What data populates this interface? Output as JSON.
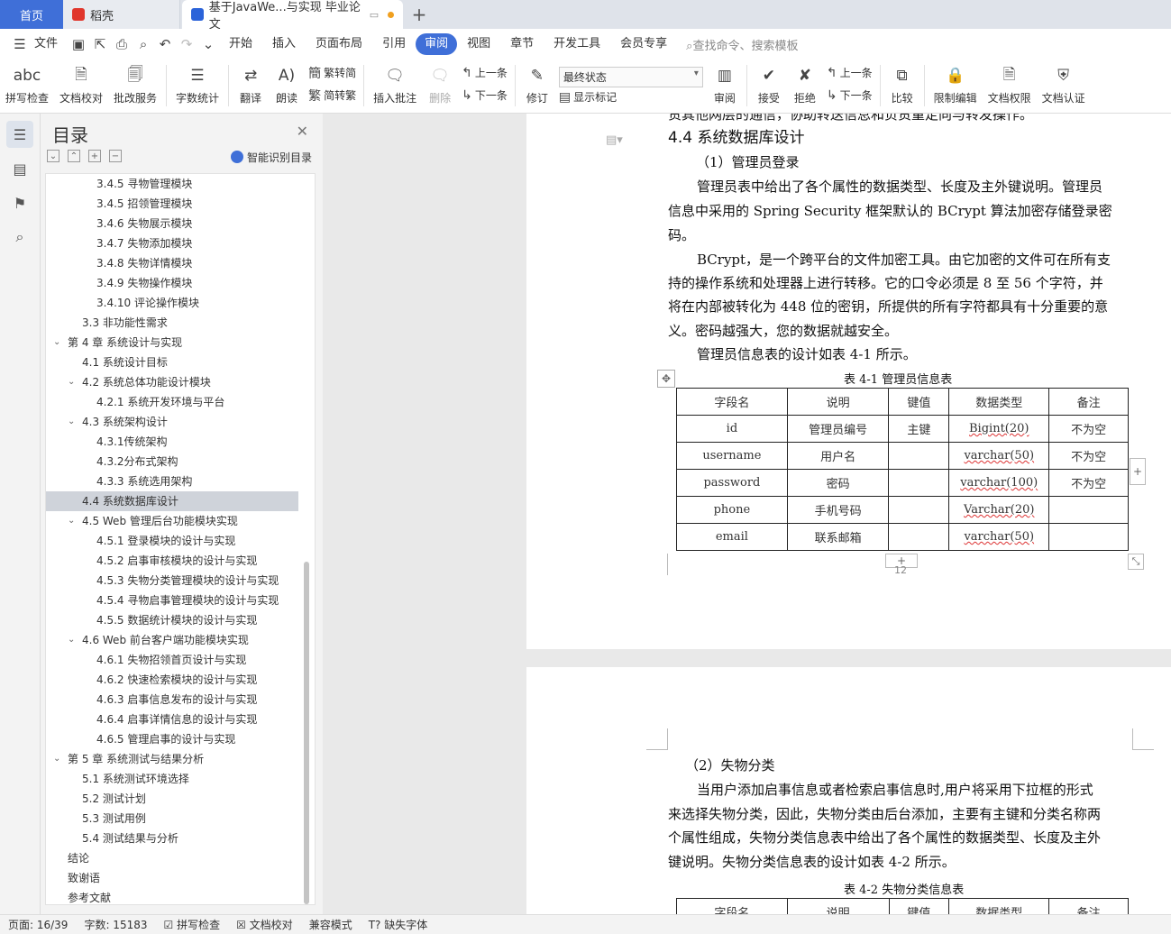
{
  "tabs": {
    "home": "首页",
    "daoke": "稻壳",
    "doc": "基于JavaWe...与实现 毕业论文"
  },
  "menu": {
    "file": "文件",
    "items": [
      "开始",
      "插入",
      "页面布局",
      "引用",
      "审阅",
      "视图",
      "章节",
      "开发工具",
      "会员专享"
    ],
    "active": "审阅",
    "search": "查找命令、搜索模板"
  },
  "toolbar": {
    "spell": "拼写检查",
    "proof": "文档校对",
    "annot": "批改服务",
    "wordcount": "字数统计",
    "translate": "翻译",
    "read": "朗读",
    "t2s": "繁转简",
    "s2t": "简转繁",
    "insert_comment": "插入批注",
    "delete": "删除",
    "prev": "上一条",
    "next": "下一条",
    "revise": "修订",
    "state": "最终状态",
    "show_marks": "显示标记",
    "review": "审阅",
    "accept": "接受",
    "reject": "拒绝",
    "prev2": "上一条",
    "next2": "下一条",
    "compare": "比较",
    "restrict": "限制编辑",
    "perm": "文档权限",
    "auth": "文档认证"
  },
  "toc": {
    "title": "目录",
    "smart": "智能识别目录",
    "items": [
      {
        "t": "3.4.5  寻物管理模块",
        "l": 3
      },
      {
        "t": "3.4.5  招领管理模块",
        "l": 3
      },
      {
        "t": "3.4.6  失物展示模块",
        "l": 3
      },
      {
        "t": "3.4.7  失物添加模块",
        "l": 3
      },
      {
        "t": "3.4.8  失物详情模块",
        "l": 3
      },
      {
        "t": "3.4.9  失物操作模块",
        "l": 3
      },
      {
        "t": "3.4.10  评论操作模块",
        "l": 3
      },
      {
        "t": "3.3 非功能性需求",
        "l": 2
      },
      {
        "t": "第 4 章   系统设计与实现",
        "l": 1,
        "exp": true
      },
      {
        "t": "4.1  系统设计目标",
        "l": 2
      },
      {
        "t": "4.2  系统总体功能设计模块",
        "l": 2,
        "exp": true
      },
      {
        "t": "4.2.1  系统开发环境与平台",
        "l": 3
      },
      {
        "t": "4.3  系统架构设计",
        "l": 2,
        "exp": true
      },
      {
        "t": "4.3.1传统架构",
        "l": 3
      },
      {
        "t": "4.3.2分布式架构",
        "l": 3
      },
      {
        "t": "4.3.3  系统选用架构",
        "l": 3
      },
      {
        "t": "4.4  系统数据库设计",
        "l": 2,
        "sel": true
      },
      {
        "t": "4.5 Web 管理后台功能模块实现",
        "l": 2,
        "exp": true
      },
      {
        "t": "4.5.1  登录模块的设计与实现",
        "l": 3
      },
      {
        "t": "4.5.2  启事审核模块的设计与实现",
        "l": 3
      },
      {
        "t": "4.5.3  失物分类管理模块的设计与实现",
        "l": 3
      },
      {
        "t": "4.5.4  寻物启事管理模块的设计与实现",
        "l": 3
      },
      {
        "t": "4.5.5  数据统计模块的设计与实现",
        "l": 3
      },
      {
        "t": "4.6 Web 前台客户端功能模块实现",
        "l": 2,
        "exp": true
      },
      {
        "t": "4.6.1  失物招领首页设计与实现",
        "l": 3
      },
      {
        "t": "4.6.2  快速检索模块的设计与实现",
        "l": 3
      },
      {
        "t": "4.6.3  启事信息发布的设计与实现",
        "l": 3
      },
      {
        "t": "4.6.4  启事详情信息的设计与实现",
        "l": 3
      },
      {
        "t": "4.6.5  管理启事的设计与实现",
        "l": 3
      },
      {
        "t": "第 5 章   系统测试与结果分析",
        "l": 1,
        "exp": true
      },
      {
        "t": "5.1  系统测试环境选择",
        "l": 2
      },
      {
        "t": "5.2  测试计划",
        "l": 2
      },
      {
        "t": "5.3  测试用例",
        "l": 2
      },
      {
        "t": "5.4  测试结果与分析",
        "l": 2
      },
      {
        "t": "结论",
        "l": 1
      },
      {
        "t": "致谢语",
        "l": 1
      },
      {
        "t": "参考文献",
        "l": 1
      }
    ]
  },
  "doc": {
    "top_line": "责其他网层的通信，协助转送信息和负责重定向与转发操作。",
    "heading": "4.4  系统数据库设计",
    "sub1": "（1）管理员登录",
    "para1": "管理员表中给出了各个属性的数据类型、长度及主外键说明。管理员",
    "para1b": "信息中采用的 Spring  Security 框架默认的 BCrypt 算法加密存储登录密",
    "para1c": "码。",
    "para2": "BCrypt，是一个跨平台的文件加密工具。由它加密的文件可在所有支",
    "para2b": "持的操作系统和处理器上进行转移。它的口令必须是 8 至 56 个字符，并",
    "para2c": "将在内部被转化为 448 位的密钥，所提供的所有字符都具有十分重要的意",
    "para2d": "义。密码越强大，您的数据就越安全。",
    "para3": "管理员信息表的设计如表 4-1 所示。",
    "table1_caption": "表 4-1  管理员信息表",
    "table1_header": [
      "字段名",
      "说明",
      "键值",
      "数据类型",
      "备注"
    ],
    "table1_rows": [
      [
        "id",
        "管理员编号",
        "主键",
        "Bigint(20)",
        "不为空"
      ],
      [
        "username",
        "用户名",
        "",
        "varchar(50)",
        "不为空"
      ],
      [
        "password",
        "密码",
        "",
        "varchar(100)",
        "不为空"
      ],
      [
        "phone",
        "手机号码",
        "",
        "Varchar(20)",
        ""
      ],
      [
        "email",
        "联系邮箱",
        "",
        "varchar(50)",
        ""
      ]
    ],
    "page_num": "12",
    "sub2": "（2）失物分类",
    "para4": "当用户添加启事信息或者检索启事信息时,用户将采用下拉框的形式",
    "para4b": "来选择失物分类，因此，失物分类由后台添加，主要有主键和分类名称两",
    "para4c": "个属性组成，失物分类信息表中给出了各个属性的数据类型、长度及主外",
    "para4d": "键说明。失物分类信息表的设计如表 4-2 所示。",
    "table2_caption": "表 4-2  失物分类信息表",
    "table2_header": [
      "字段名",
      "说明",
      "键值",
      "数据类型",
      "备注"
    ]
  },
  "status": {
    "page": "页面: 16/39",
    "words": "字数: 15183",
    "spell": "拼写检查",
    "proof": "文档校对",
    "compat": "兼容模式",
    "fonts": "缺失字体"
  }
}
